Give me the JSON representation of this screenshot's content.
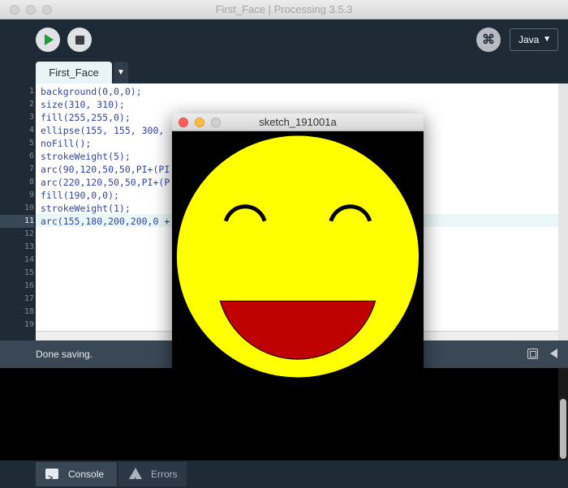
{
  "window": {
    "title": "First_Face | Processing 3.5.3"
  },
  "toolbar": {
    "run_icon": "play-icon",
    "stop_icon": "stop-icon",
    "debug_icon": "debugger-icon",
    "debug_glyph": "⌘",
    "mode": "Java",
    "mode_caret": "▼"
  },
  "tabs": {
    "active_label": "First_Face",
    "menu_glyph": "▼"
  },
  "editor": {
    "current_line": 11,
    "line_numbers": [
      "1",
      "2",
      "3",
      "4",
      "5",
      "6",
      "7",
      "8",
      "9",
      "10",
      "11",
      "12",
      "13",
      "14",
      "15",
      "16",
      "17",
      "18",
      "19"
    ],
    "lines": [
      "background(0,0,0);",
      "size(310, 310);",
      "fill(255,255,0);",
      "ellipse(155, 155, 300,",
      "noFill();",
      "strokeWeight(5);",
      "arc(90,120,50,50,PI+(PI",
      "arc(220,120,50,50,PI+(P",
      "fill(190,0,0);",
      "strokeWeight(1);",
      "arc(155,180,200,200,0 +"
    ]
  },
  "status": {
    "message": "Done saving."
  },
  "footer": {
    "console_label": "Console",
    "errors_label": "Errors"
  },
  "sketch": {
    "title": "sketch_191001a",
    "background": "#000000",
    "face_color": "#ffff00",
    "mouth_color": "#be0000"
  },
  "colors": {
    "ide_dark": "#1e2a36",
    "status_bar": "#3a4856",
    "code_text": "#33469a",
    "run_green": "#1e9b3c"
  }
}
